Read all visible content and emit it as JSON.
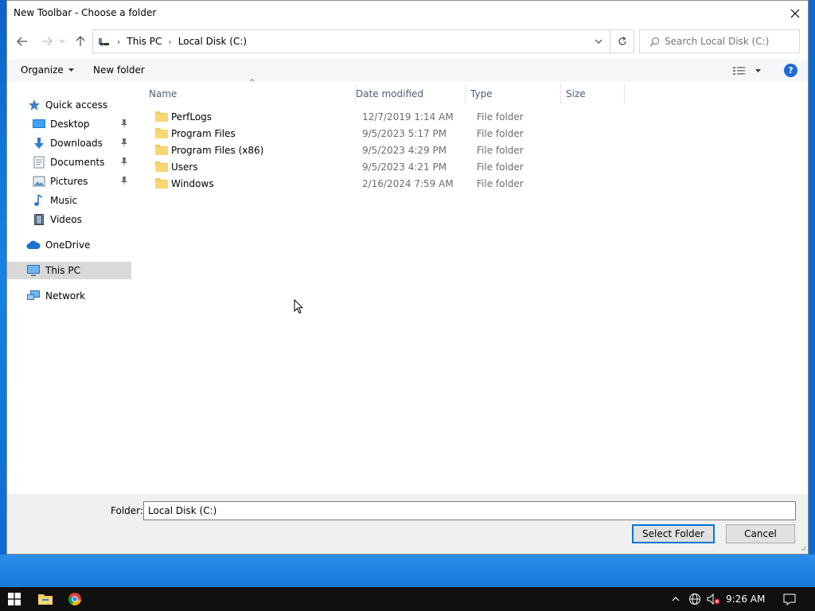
{
  "dialog": {
    "title": "New Toolbar - Choose a folder"
  },
  "address": {
    "crumbs": [
      "This PC",
      "Local Disk (C:)"
    ],
    "search_placeholder": "Search Local Disk (C:)"
  },
  "commands": {
    "organize": "Organize",
    "new_folder": "New folder",
    "help": "?"
  },
  "nav": {
    "quick_access": "Quick access",
    "desktop": "Desktop",
    "downloads": "Downloads",
    "documents": "Documents",
    "pictures": "Pictures",
    "music": "Music",
    "videos": "Videos",
    "onedrive": "OneDrive",
    "this_pc": "This PC",
    "network": "Network"
  },
  "columns": {
    "name": "Name",
    "date": "Date modified",
    "type": "Type",
    "size": "Size"
  },
  "files": [
    {
      "name": "PerfLogs",
      "date": "12/7/2019 1:14 AM",
      "type": "File folder"
    },
    {
      "name": "Program Files",
      "date": "9/5/2023 5:17 PM",
      "type": "File folder"
    },
    {
      "name": "Program Files (x86)",
      "date": "9/5/2023 4:29 PM",
      "type": "File folder"
    },
    {
      "name": "Users",
      "date": "9/5/2023 4:21 PM",
      "type": "File folder"
    },
    {
      "name": "Windows",
      "date": "2/16/2024 7:59 AM",
      "type": "File folder"
    }
  ],
  "footer": {
    "folder_label": "Folder:",
    "folder_value": "Local Disk (C:)",
    "select_button": "Select Folder",
    "cancel_button": "Cancel"
  },
  "taskbar": {
    "clock": "9:26 AM"
  },
  "colors": {
    "accent": "#0078d7",
    "folder": "#f4c95d",
    "selected_nav": "#d9d9d9"
  }
}
